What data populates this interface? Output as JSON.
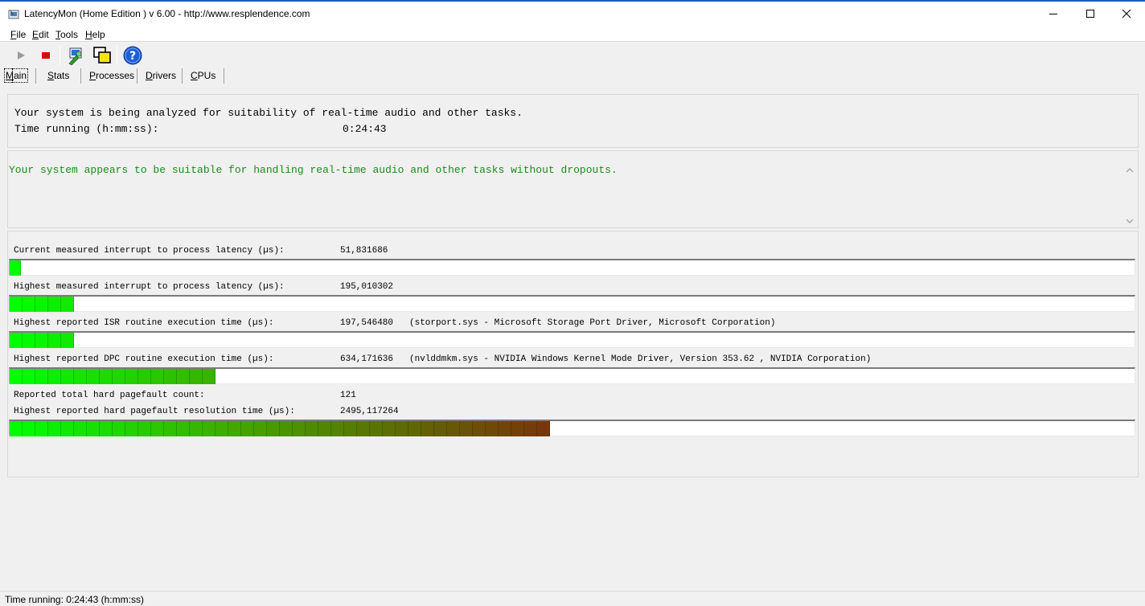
{
  "window": {
    "title": "LatencyMon  (Home Edition )  v 6.00 - http://www.resplendence.com",
    "controls": [
      "minimize",
      "maximize",
      "close"
    ]
  },
  "menu": {
    "items": [
      {
        "label": "File",
        "accel": "F",
        "rest": "ile"
      },
      {
        "label": "Edit",
        "accel": "E",
        "rest": "dit"
      },
      {
        "label": "Tools",
        "accel": "T",
        "rest": "ools"
      },
      {
        "label": "Help",
        "accel": "H",
        "rest": "elp"
      }
    ]
  },
  "toolbar": {
    "buttons": [
      "play-icon",
      "stop-icon",
      "drivers-tool-icon",
      "windows-icon",
      "help-icon"
    ]
  },
  "tabs": [
    {
      "label": "Main",
      "accel": "M",
      "rest": "ain",
      "active": true
    },
    {
      "label": "Stats",
      "accel": "S",
      "rest": "tats",
      "active": false
    },
    {
      "label": "Processes",
      "accel": "P",
      "rest": "rocesses",
      "active": false
    },
    {
      "label": "Drivers",
      "accel": "D",
      "rest": "rivers",
      "active": false
    },
    {
      "label": "CPUs",
      "accel": "C",
      "rest": "PUs",
      "active": false
    }
  ],
  "analysis": {
    "line1": "Your system is being analyzed for suitability of real-time audio and other tasks.",
    "time_label": "Time running (h:mm:ss):",
    "time_value": "0:24:43"
  },
  "verdict": {
    "text": "Your system appears to be suitable for handling real-time audio and other tasks without dropouts.",
    "color": "#1a8c1a"
  },
  "metrics": [
    {
      "label": "Current measured interrupt to process latency (µs):",
      "value": "51,831686",
      "desc": "",
      "bar_segments": 1
    },
    {
      "label": "Highest measured interrupt to process latency (µs):",
      "value": "195,010302",
      "desc": "",
      "bar_segments": 5
    },
    {
      "label": "Highest reported ISR routine execution time (µs):",
      "value": "197,546480",
      "desc": "(storport.sys - Microsoft Storage Port Driver, Microsoft Corporation)",
      "bar_segments": 5
    },
    {
      "label": "Highest reported DPC routine execution time (µs):",
      "value": "634,171636",
      "desc": "(nvlddmkm.sys - NVIDIA Windows Kernel Mode Driver, Version 353.62 , NVIDIA Corporation)",
      "bar_segments": 16
    },
    {
      "label": "Reported total hard pagefault count:",
      "value": "121",
      "desc": "",
      "bar_segments": 0
    },
    {
      "label": "Highest reported hard pagefault resolution time (µs):",
      "value": "2495,117264",
      "desc": "",
      "bar_segments": 42
    }
  ],
  "status": {
    "text": "Time running: 0:24:43  (h:mm:ss)"
  }
}
